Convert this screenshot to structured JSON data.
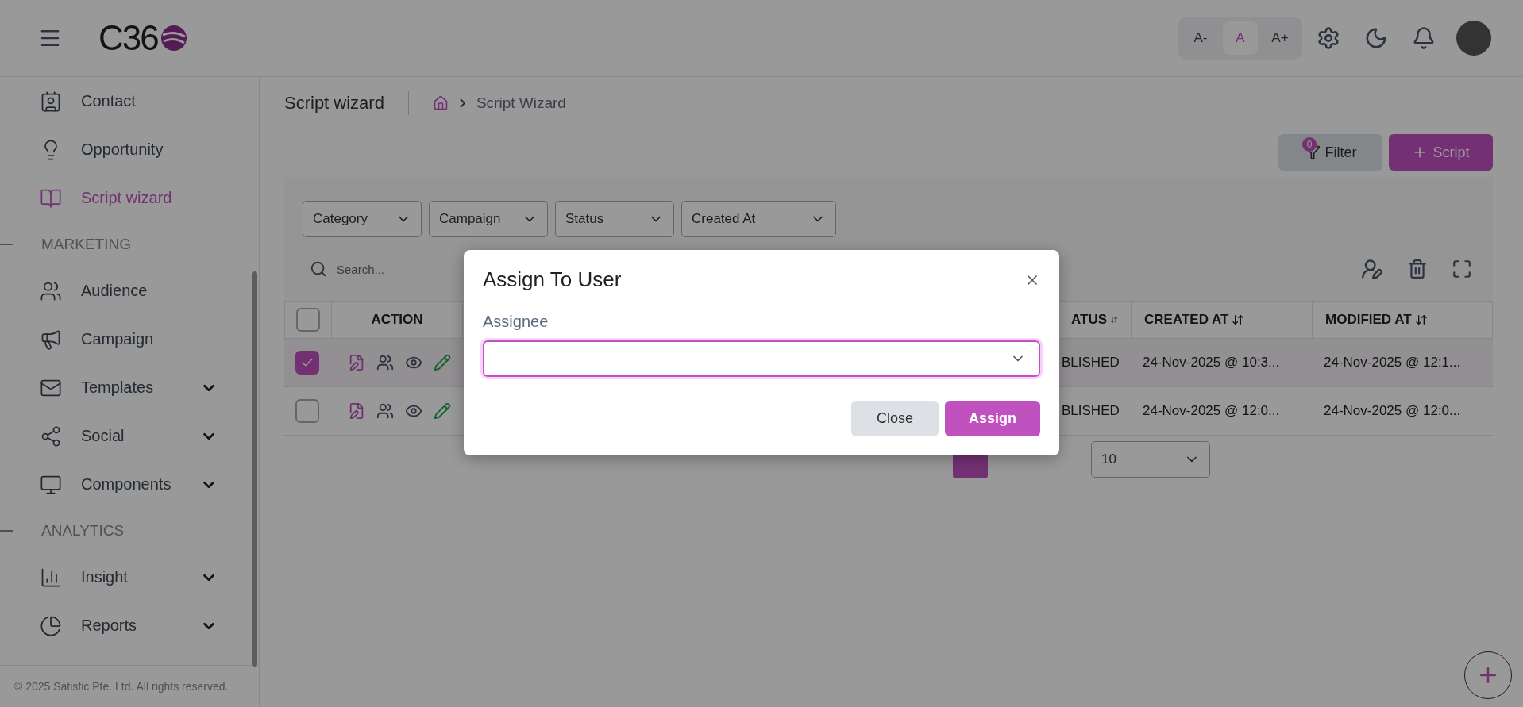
{
  "header": {
    "logo": "C36",
    "font_sizes": [
      {
        "label": "A-",
        "selected": false
      },
      {
        "label": "A",
        "selected": true
      },
      {
        "label": "A+",
        "selected": false
      }
    ]
  },
  "sidebar": {
    "sections": [
      {
        "items": [
          {
            "kind": "link",
            "label": "Contact",
            "selected": false
          },
          {
            "kind": "link",
            "label": "Opportunity",
            "selected": false
          },
          {
            "kind": "link",
            "label": "Script wizard",
            "selected": true
          }
        ]
      },
      {
        "heading": "MARKETING",
        "items": [
          {
            "kind": "link",
            "label": "Audience",
            "selected": false
          },
          {
            "kind": "link",
            "label": "Campaign",
            "selected": false
          },
          {
            "kind": "group",
            "label": "Templates",
            "selected": false,
            "expanded": false
          },
          {
            "kind": "group",
            "label": "Social",
            "selected": false,
            "expanded": false
          },
          {
            "kind": "group",
            "label": "Components",
            "selected": false,
            "expanded": false
          }
        ]
      },
      {
        "heading": "ANALYTICS",
        "items": [
          {
            "kind": "group",
            "label": "Insight",
            "selected": false,
            "expanded": false
          },
          {
            "kind": "group",
            "label": "Reports",
            "selected": false,
            "expanded": false
          }
        ]
      }
    ],
    "footer": "© 2025 Satisfic Pte. Ltd. All rights reserved."
  },
  "page": {
    "title": "Script wizard",
    "breadcrumb": "Script Wizard"
  },
  "toolbar": {
    "filter": {
      "label": "Filter",
      "count": "0"
    },
    "add": {
      "label": "Script"
    }
  },
  "filters": [
    "Category",
    "Campaign",
    "Status",
    "Created At"
  ],
  "search": {
    "placeholder": "Search..."
  },
  "table": {
    "columns": [
      {
        "label": "ACTION",
        "sortable": false
      },
      {
        "label": "ATUS",
        "sortable": true
      },
      {
        "label": "CREATED AT",
        "sortable": true
      },
      {
        "label": "MODIFIED AT",
        "sortable": true
      }
    ],
    "all_checked": false,
    "rows": [
      {
        "selected": true,
        "status": "BLISHED",
        "created": "24-Nov-2025 @ 10:3...",
        "modified": "24-Nov-2025 @ 12:1..."
      },
      {
        "selected": false,
        "status": "BLISHED",
        "created": "24-Nov-2025 @ 12:0...",
        "modified": "24-Nov-2025 @ 12:0..."
      }
    ]
  },
  "pagination": {
    "page_size": "10"
  },
  "modal": {
    "title": "Assign To User",
    "field_label": "Assignee",
    "buttons": [
      {
        "kind": "secondary",
        "label": "Close"
      },
      {
        "kind": "primary",
        "label": "Assign"
      }
    ]
  }
}
